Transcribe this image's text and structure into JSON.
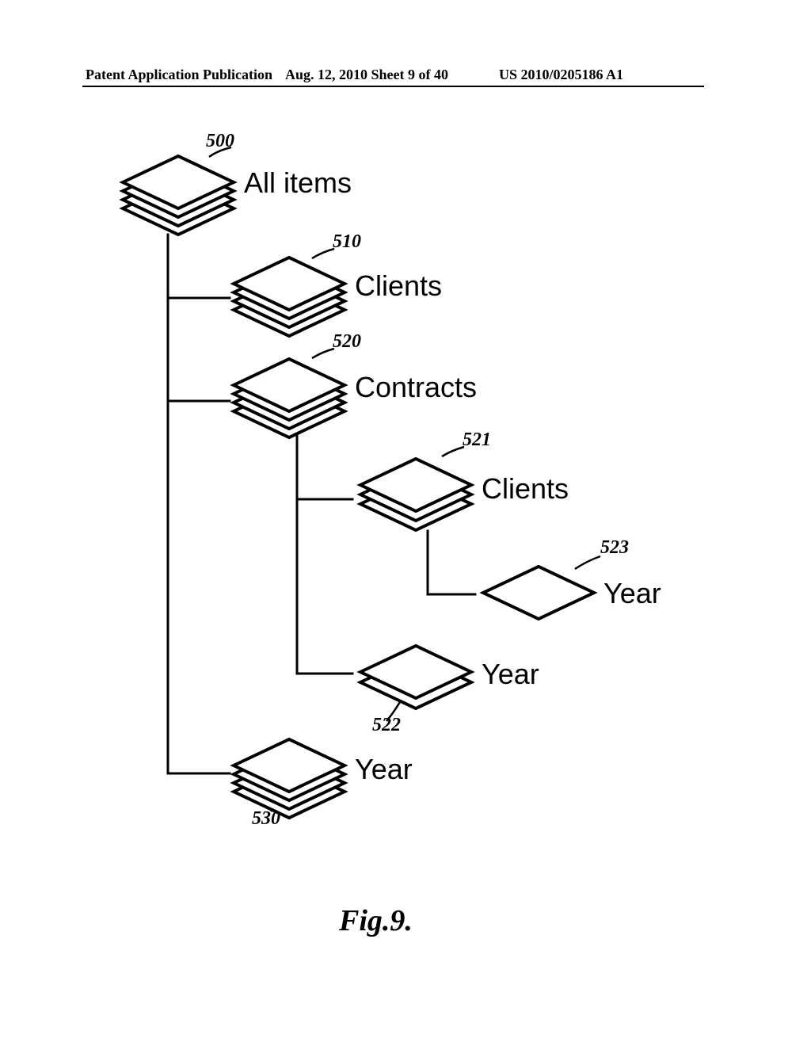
{
  "header": {
    "left": "Patent Application Publication",
    "mid": "Aug. 12, 2010  Sheet 9 of 40",
    "right": "US 2010/0205186 A1"
  },
  "nodes": {
    "root": {
      "label": "All items",
      "ref": "500"
    },
    "clients": {
      "label": "Clients",
      "ref": "510"
    },
    "contracts": {
      "label": "Contracts",
      "ref": "520"
    },
    "clients2": {
      "label": "Clients",
      "ref": "521"
    },
    "year523": {
      "label": "Year",
      "ref": "523"
    },
    "year522": {
      "label": "Year",
      "ref": "522"
    },
    "year530": {
      "label": "Year",
      "ref": "530"
    }
  },
  "figure_label": "Fig.9."
}
